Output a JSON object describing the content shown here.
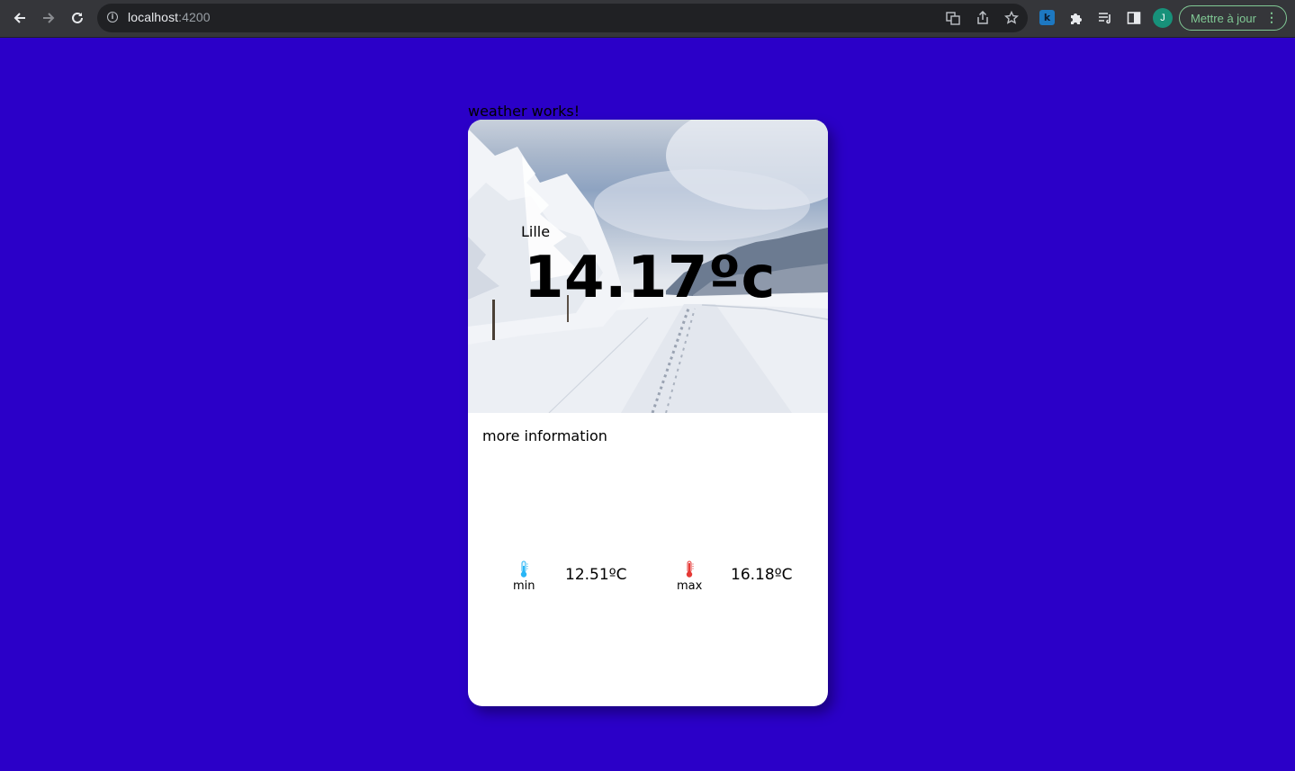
{
  "browser": {
    "url_host": "localhost",
    "url_port": ":4200",
    "profile_initial": "J",
    "update_label": "Mettre à jour",
    "extension_badge": "k"
  },
  "page": {
    "heading": "weather works!"
  },
  "weather": {
    "city": "Lille",
    "temperature": "14.17ºc",
    "more_info_label": "more information",
    "min_label": "min",
    "min_value": "12.51ºC",
    "max_label": "max",
    "max_value": "16.18ºC"
  },
  "colors": {
    "page_background": "#2b00c8",
    "toolbar": "#35363a",
    "update_button": "#81c995",
    "min_icon": "#29b6f6",
    "max_icon": "#e53935"
  }
}
